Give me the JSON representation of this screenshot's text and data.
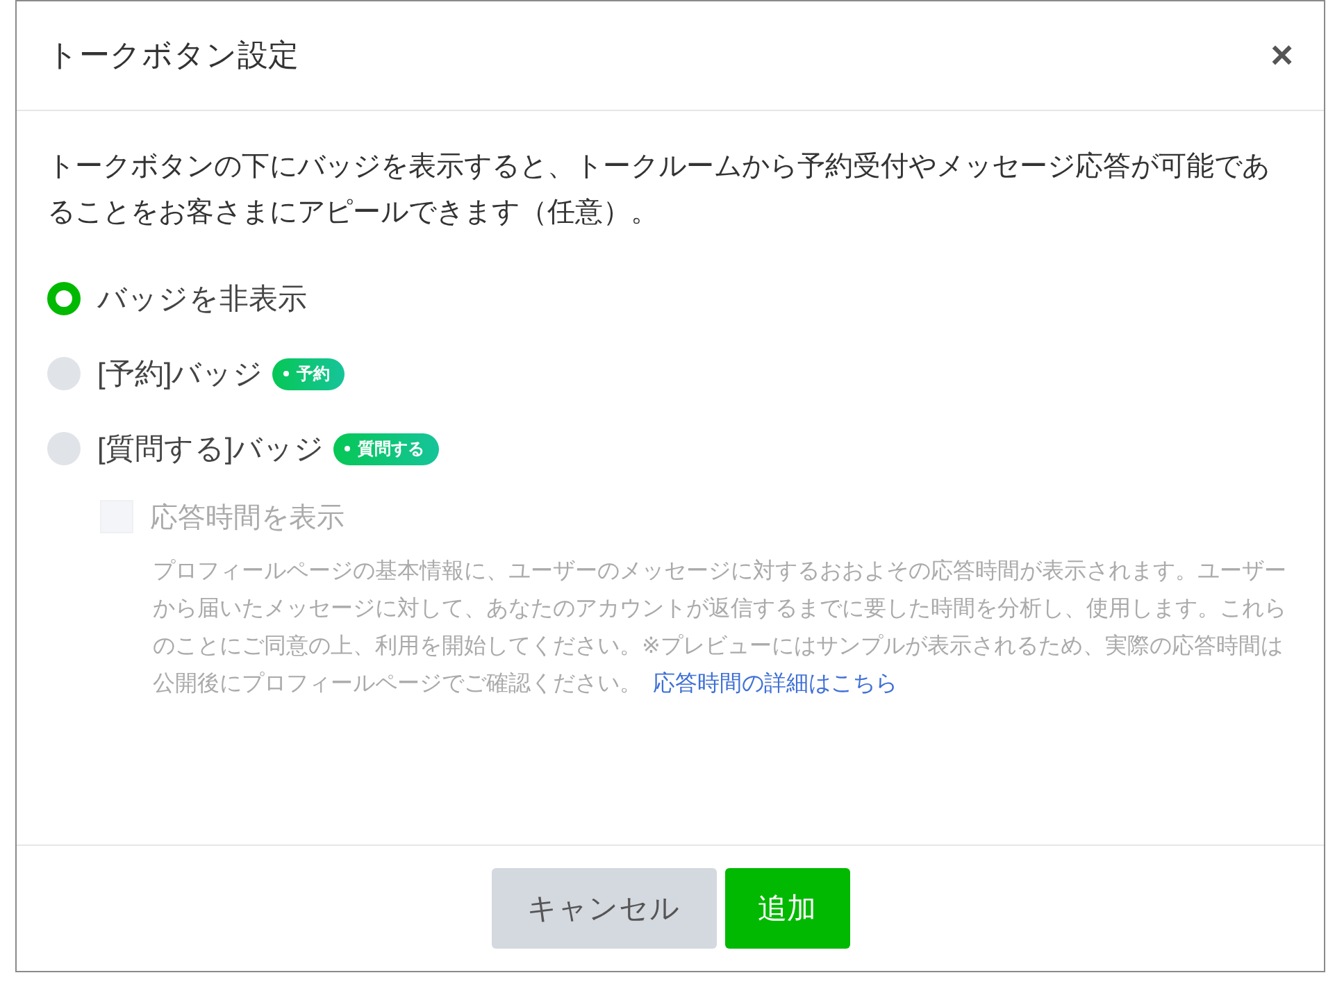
{
  "dialog": {
    "title": "トークボタン設定",
    "close": "×"
  },
  "description": "トークボタンの下にバッジを表示すると、トークルームから予約受付やメッセージ応答が可能であることをお客さまにアピールできます（任意）。",
  "options": [
    {
      "label": "バッジを非表示",
      "selected": true
    },
    {
      "label": "[予約]バッジ",
      "badge": "予約",
      "selected": false
    },
    {
      "label": "[質問する]バッジ",
      "badge": "質問する",
      "selected": false
    }
  ],
  "response_time": {
    "label": "応答時間を表示",
    "checked": false,
    "disabled": true,
    "note": "プロフィールページの基本情報に、ユーザーのメッセージに対するおおよその応答時間が表示されます。ユーザーから届いたメッセージに対して、あなたのアカウントが返信するまでに要した時間を分析し、使用します。これらのことにご同意の上、利用を開始してください。※プレビューにはサンプルが表示されるため、実際の応答時間は公開後にプロフィールページでご確認ください。",
    "link": "応答時間の詳細はこちら"
  },
  "buttons": [
    {
      "label": "キャンセル",
      "kind": "secondary"
    },
    {
      "label": "追加",
      "kind": "primary"
    }
  ]
}
